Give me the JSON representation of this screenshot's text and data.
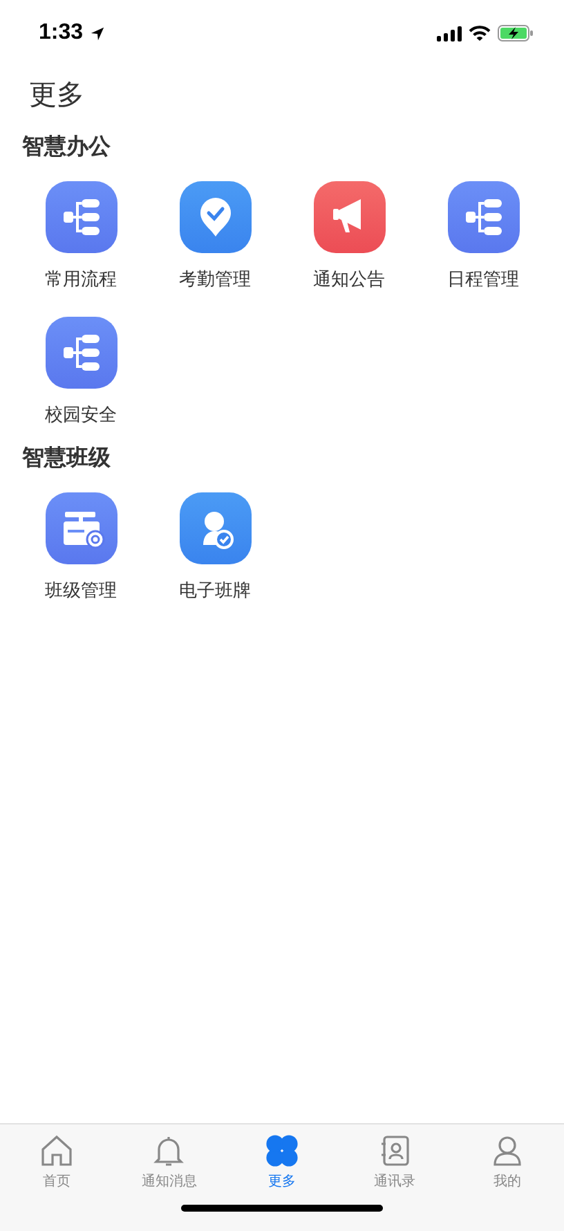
{
  "status_bar": {
    "time": "1:33"
  },
  "title": "更多",
  "sections": [
    {
      "title": "智慧办公",
      "items": [
        {
          "label": "常用流程",
          "kind": "flow"
        },
        {
          "label": "考勤管理",
          "kind": "pin"
        },
        {
          "label": "通知公告",
          "kind": "megaphone"
        },
        {
          "label": "日程管理",
          "kind": "flow"
        },
        {
          "label": "校园安全",
          "kind": "flow"
        }
      ]
    },
    {
      "title": "智慧班级",
      "items": [
        {
          "label": "班级管理",
          "kind": "classcard"
        },
        {
          "label": "电子班牌",
          "kind": "person"
        }
      ]
    }
  ],
  "tab_bar": [
    {
      "label": "首页",
      "kind": "home",
      "selected": false
    },
    {
      "label": "通知消息",
      "kind": "bell",
      "selected": false
    },
    {
      "label": "更多",
      "kind": "more",
      "selected": true
    },
    {
      "label": "通讯录",
      "kind": "contacts",
      "selected": false
    },
    {
      "label": "我的",
      "kind": "me",
      "selected": false
    }
  ]
}
